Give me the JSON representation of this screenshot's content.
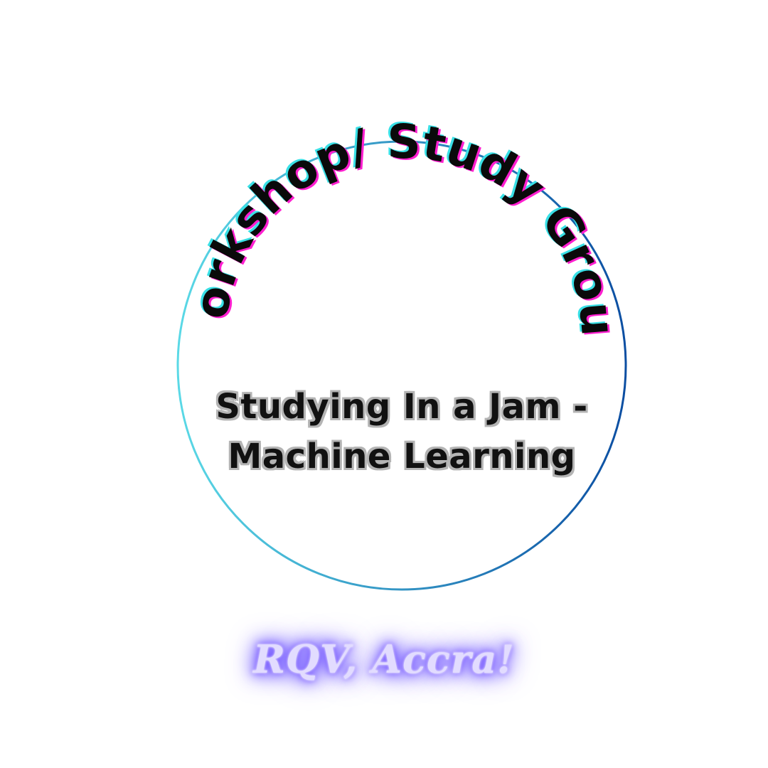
{
  "badge": {
    "arc_text": "Workshop/ Study Group",
    "title_line_1": "Studying In a Jam -",
    "title_line_2": "Machine Learning",
    "footer": "RQV, Accra!",
    "colors": {
      "ring_start": "#5ad9e6",
      "ring_end": "#0b4ea2",
      "arc_text": "#0a0a0a",
      "arc_offset_cyan": "#39e0e6",
      "arc_offset_magenta": "#ff1fd0",
      "title_text": "#111111",
      "title_outline": "#b4b4b4",
      "footer_glow": "#6a4dff"
    }
  }
}
